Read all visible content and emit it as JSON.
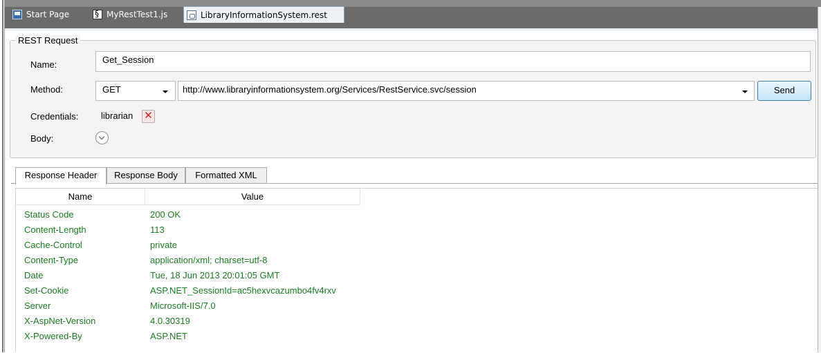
{
  "document_tabs": [
    {
      "label": "Start Page",
      "icon": "start-page-icon",
      "active": false
    },
    {
      "label": "MyRestTest1.js",
      "icon": "script-file-icon",
      "active": false
    },
    {
      "label": "LibraryInformationSystem.rest",
      "icon": "rest-file-icon",
      "active": true
    }
  ],
  "request": {
    "group_title": "REST Request",
    "name_label": "Name:",
    "name_value": "Get_Session",
    "method_label": "Method:",
    "method_value": "GET",
    "url_value": "http://www.libraryinformationsystem.org/Services/RestService.svc/session",
    "send_label": "Send",
    "credentials_label": "Credentials:",
    "credentials_value": "librarian",
    "body_label": "Body:"
  },
  "response_tabs": [
    "Response Header",
    "Response Body",
    "Formatted XML"
  ],
  "active_response_tab": "Response Header",
  "response_header": {
    "columns": [
      "Name",
      "Value"
    ],
    "rows": [
      {
        "name": "Status Code",
        "value": "200 OK"
      },
      {
        "name": "Content-Length",
        "value": "113"
      },
      {
        "name": "Cache-Control",
        "value": "private"
      },
      {
        "name": "Content-Type",
        "value": "application/xml; charset=utf-8"
      },
      {
        "name": "Date",
        "value": "Tue, 18 Jun 2013 20:01:05 GMT"
      },
      {
        "name": "Set-Cookie",
        "value": "ASP.NET_SessionId=ac5hexvcazumbo4fv4rxv"
      },
      {
        "name": "Server",
        "value": "Microsoft-IIS/7.0"
      },
      {
        "name": "X-AspNet-Version",
        "value": "4.0.30319"
      },
      {
        "name": "X-Powered-By",
        "value": "ASP.NET"
      }
    ]
  },
  "colors": {
    "header_value_text": "#1b7d21",
    "send_button_border": "#3c7fb1"
  }
}
